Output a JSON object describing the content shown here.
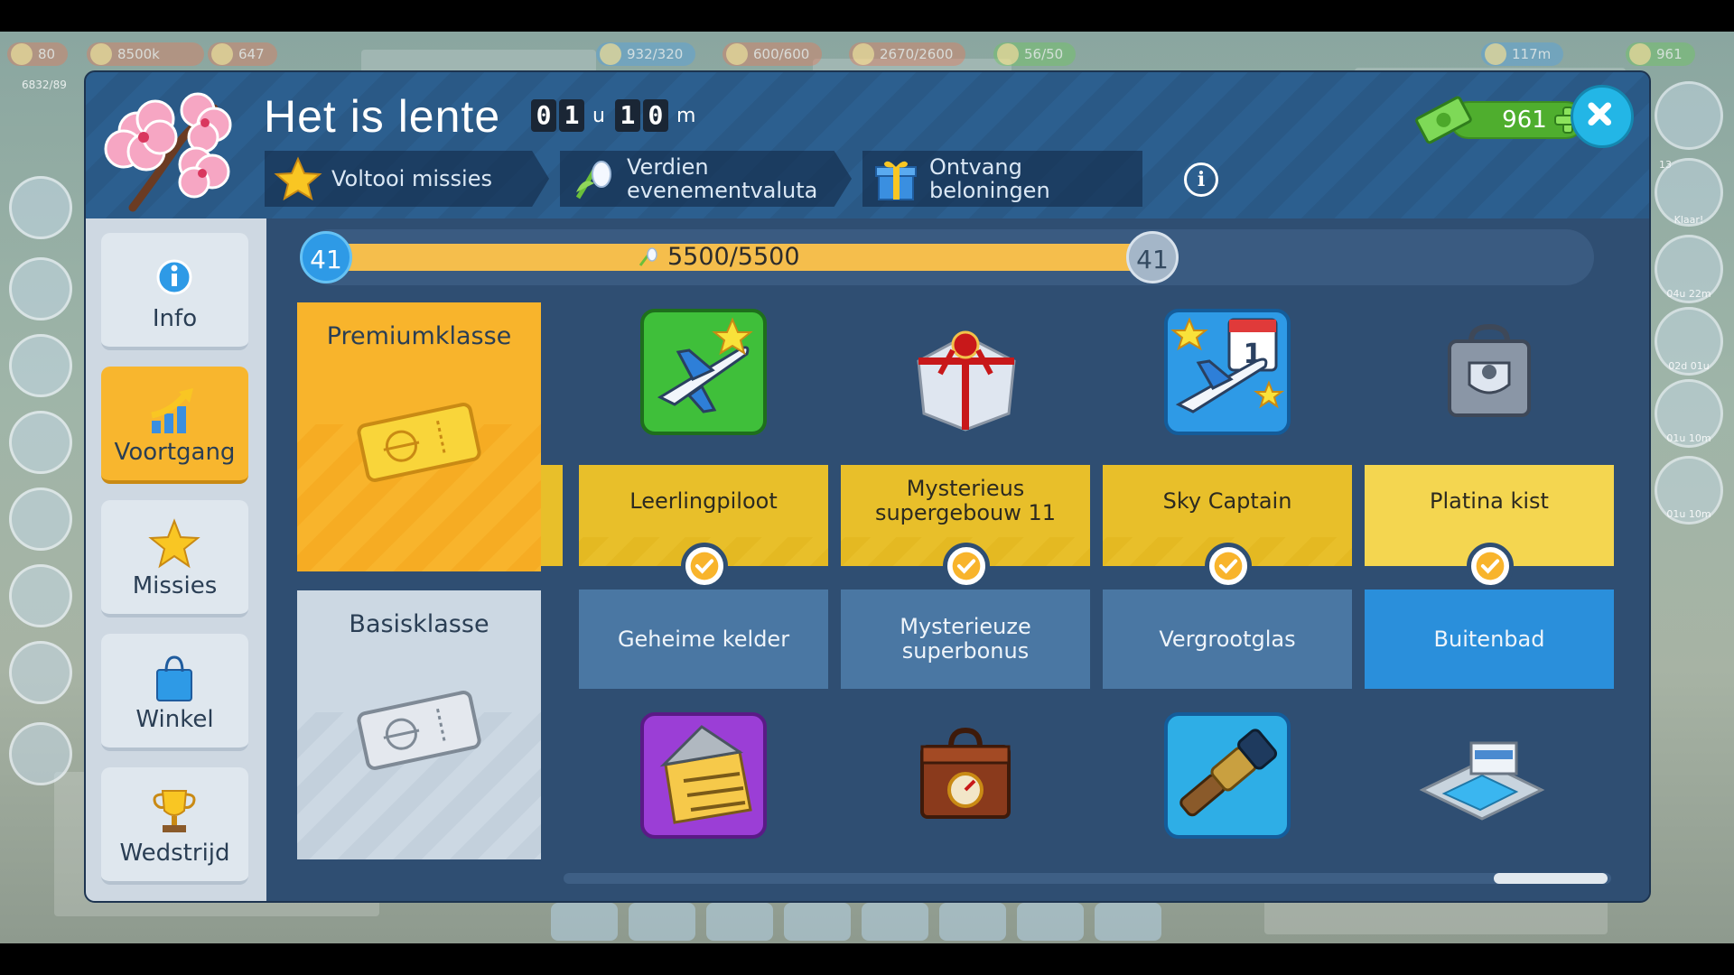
{
  "topbar": {
    "resources": [
      "80",
      "8500k",
      "647",
      "932/320",
      "600/600",
      "2670/2600",
      "56/50",
      "117m",
      "961"
    ],
    "population": "6832/89"
  },
  "right_sidebar": {
    "labels": [
      "13",
      "Klaar!",
      "04u 22m",
      "02d 01u",
      "01u 10m",
      "01u 10m"
    ]
  },
  "header": {
    "title": "Het is lente",
    "timer": {
      "hours": [
        "0",
        "1"
      ],
      "hours_unit": "u",
      "minutes": [
        "1",
        "0"
      ],
      "minutes_unit": "m"
    },
    "currency_value": "961",
    "tabs": [
      {
        "label": "Voltooi missies",
        "icon": "star-icon"
      },
      {
        "label": "Verdien evenementvaluta",
        "icon": "snowdrop-icon"
      },
      {
        "label": "Ontvang beloningen",
        "icon": "gift-icon"
      }
    ],
    "info_symbol": "i"
  },
  "nav": {
    "items": [
      {
        "label": "Info",
        "icon": "info-icon"
      },
      {
        "label": "Voortgang",
        "icon": "progress-arrow-icon",
        "active": true
      },
      {
        "label": "Missies",
        "icon": "star-icon"
      },
      {
        "label": "Winkel",
        "icon": "shopping-bag-icon"
      },
      {
        "label": "Wedstrijd",
        "icon": "trophy-icon"
      }
    ]
  },
  "progress": {
    "level_current": "41",
    "level_next": "41",
    "text": "5500/5500",
    "fraction": 1.0
  },
  "tiers": {
    "premium": "Premiumklasse",
    "basic": "Basisklasse"
  },
  "rewards": [
    {
      "premium": "Leerlingpiloot",
      "premium_icon": "jet-plane-star-icon",
      "basic": "Geheime kelder",
      "basic_icon": "secret-cellar-icon"
    },
    {
      "premium": "Mysterieus supergebouw 11",
      "premium_icon": "mystery-gift-box-icon",
      "basic": "Mysterieuze superbonus",
      "basic_icon": "mystery-chest-icon"
    },
    {
      "premium": "Sky Captain",
      "premium_icon": "plane-calendar-icon",
      "basic": "Vergrootglas",
      "basic_icon": "telescope-icon"
    },
    {
      "premium": "Platina kist",
      "premium_icon": "platinum-chest-icon",
      "basic": "Buitenbad",
      "basic_icon": "outdoor-pool-icon"
    }
  ],
  "colors": {
    "dialog_bg": "#2f4e72",
    "gold": "#f8b42c",
    "accent_blue": "#2a8fdb",
    "currency_green": "#4fae2e",
    "close_blue": "#23b6e6"
  }
}
